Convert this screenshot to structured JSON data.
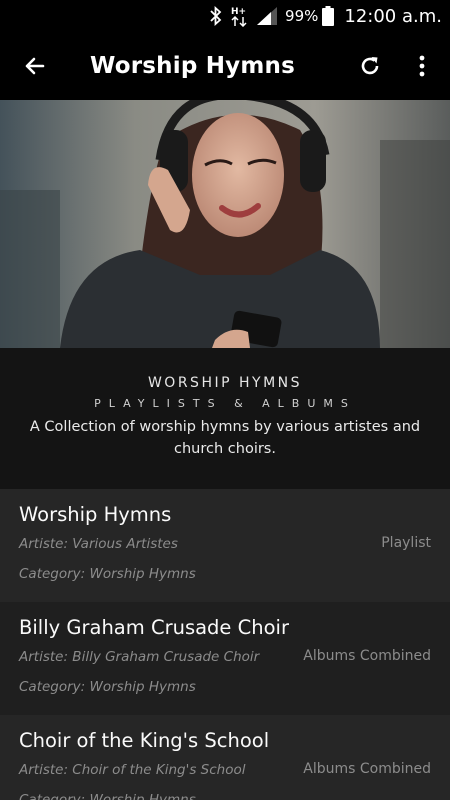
{
  "status_bar": {
    "battery_percent": "99%",
    "time": "12:00 a.m.",
    "network": "H+",
    "icons": [
      "bluetooth-icon",
      "network-arrows-icon",
      "signal-icon",
      "battery-icon"
    ]
  },
  "app_bar": {
    "title": "Worship Hymns",
    "icons": [
      "back-arrow-icon",
      "refresh-icon",
      "overflow-menu-icon"
    ]
  },
  "intro": {
    "heading": "WORSHIP HYMNS",
    "subheading": "PLAYLISTS & ALBUMS",
    "description": "A Collection of worship hymns by various artistes and church choirs."
  },
  "items": [
    {
      "name": "Worship Hymns",
      "artist": "Artiste: Various Artistes",
      "type": "Playlist",
      "category": "Category: Worship Hymns"
    },
    {
      "name": "Billy Graham Crusade Choir",
      "artist": "Artiste: Billy Graham Crusade Choir",
      "type": "Albums Combined",
      "category": "Category: Worship Hymns"
    },
    {
      "name": "Choir of the King's School",
      "artist": "Artiste: Choir of the King's School",
      "type": "Albums Combined",
      "category": "Category: Worship Hymns"
    }
  ],
  "colors": {
    "app_bar": "#000000",
    "intro_background": "#141414",
    "row_background": "#262626",
    "row_background_alt": "#1f1f1f",
    "secondary_text": "#8c8c8c"
  }
}
